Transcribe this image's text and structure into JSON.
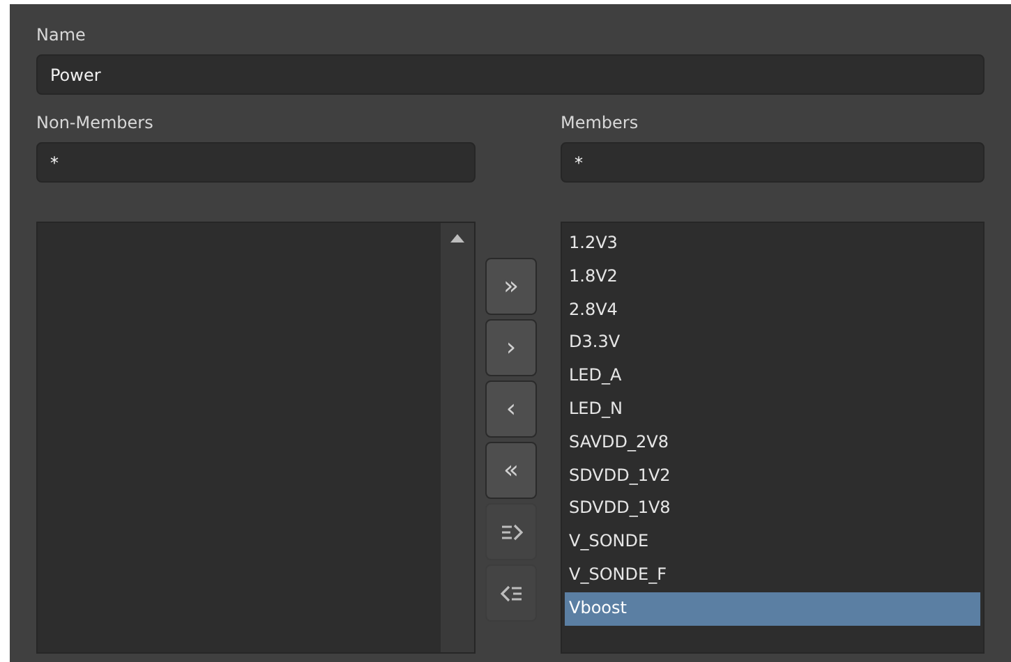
{
  "name_field": {
    "label": "Name",
    "value": "Power"
  },
  "non_members": {
    "label": "Non-Members",
    "filter": "*"
  },
  "members": {
    "label": "Members",
    "filter": "*",
    "items": [
      {
        "text": "1.2V3",
        "selected": false
      },
      {
        "text": "1.8V2",
        "selected": false
      },
      {
        "text": "2.8V4",
        "selected": false
      },
      {
        "text": "D3.3V",
        "selected": false
      },
      {
        "text": "LED_A",
        "selected": false
      },
      {
        "text": "LED_N",
        "selected": false
      },
      {
        "text": "SAVDD_2V8",
        "selected": false
      },
      {
        "text": "SDVDD_1V2",
        "selected": false
      },
      {
        "text": "SDVDD_1V8",
        "selected": false
      },
      {
        "text": "V_SONDE",
        "selected": false
      },
      {
        "text": "V_SONDE_F",
        "selected": false
      },
      {
        "text": "Vboost",
        "selected": true
      }
    ]
  },
  "transfer_buttons": [
    {
      "kind": "text",
      "label": "»",
      "disabled": false
    },
    {
      "kind": "text",
      "label": "›",
      "disabled": false
    },
    {
      "kind": "text",
      "label": "‹",
      "disabled": false
    },
    {
      "kind": "text",
      "label": "«",
      "disabled": false
    },
    {
      "kind": "move-right",
      "disabled": true
    },
    {
      "kind": "move-left",
      "disabled": true
    }
  ]
}
